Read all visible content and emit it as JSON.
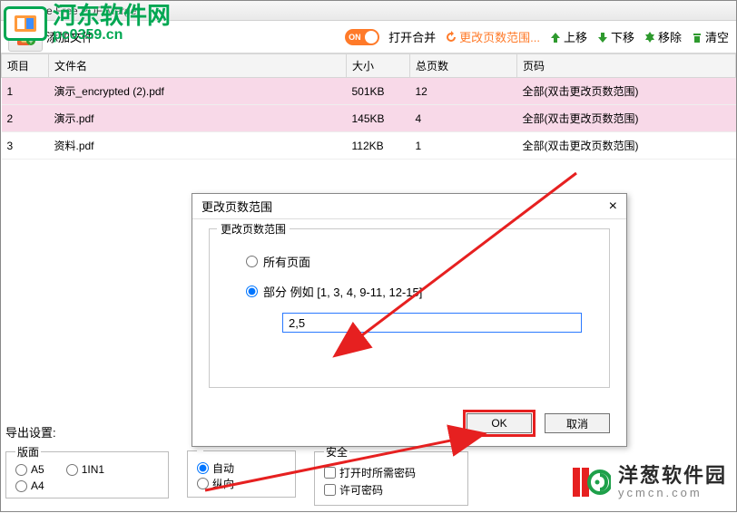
{
  "window": {
    "title": "PDFMate Free PDF Merger"
  },
  "watermark": {
    "text": "河东软件网",
    "url": "pc0359.cn"
  },
  "toolbar": {
    "addFile": "添加文件",
    "toggle": "ON",
    "openMerge": "打开合并",
    "changeRange": "更改页数范围...",
    "up": "上移",
    "down": "下移",
    "remove": "移除",
    "clear": "清空"
  },
  "table": {
    "headers": {
      "idx": "项目",
      "name": "文件名",
      "size": "大小",
      "pages": "总页数",
      "range": "页码"
    },
    "rows": [
      {
        "idx": "1",
        "name": "演示_encrypted (2).pdf",
        "size": "501KB",
        "pages": "12",
        "range": "全部(双击更改页数范围)"
      },
      {
        "idx": "2",
        "name": "演示.pdf",
        "size": "145KB",
        "pages": "4",
        "range": "全部(双击更改页数范围)"
      },
      {
        "idx": "3",
        "name": "资料.pdf",
        "size": "112KB",
        "pages": "1",
        "range": "全部(双击更改页数范围)"
      }
    ]
  },
  "dialog": {
    "title": "更改页数范围",
    "groupTitle": "更改页数范围",
    "all": "所有页面",
    "partial": "部分 例如 [1, 3, 4, 9-11, 12-15]",
    "value": "2,5",
    "ok": "OK",
    "cancel": "取消"
  },
  "export": {
    "label": "导出设置:",
    "layoutLegend": "版面",
    "a5": "A5",
    "a4": "A4",
    "n1": "1IN1",
    "auto": "自动",
    "portrait": "纵向",
    "secLegend": "安全",
    "needPwd": "打开时所需密码",
    "permPwd": "许可密码"
  },
  "onion": {
    "text": "洋葱软件园",
    "url": "ycmcn.com"
  }
}
